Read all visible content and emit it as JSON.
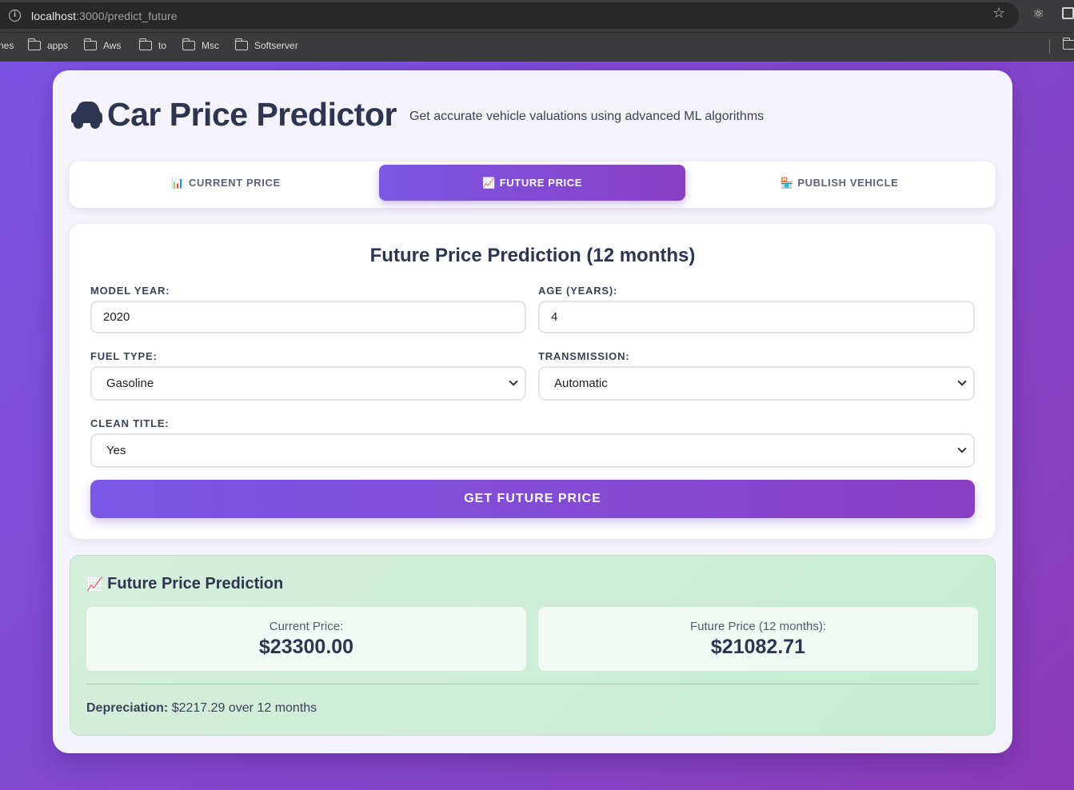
{
  "browser": {
    "url_host": "localhost",
    "url_path": ":3000/predict_future",
    "bookmarks": [
      {
        "label": "nes"
      },
      {
        "label": "apps"
      },
      {
        "label": "Aws"
      },
      {
        "label": "to"
      },
      {
        "label": "Msc"
      },
      {
        "label": "Softserver"
      }
    ]
  },
  "app": {
    "title": "Car Price Predictor",
    "subtitle": "Get accurate vehicle valuations using advanced ML algorithms"
  },
  "tabs": [
    {
      "icon": "📊",
      "label": "CURRENT PRICE",
      "active": false
    },
    {
      "icon": "📈",
      "label": "FUTURE PRICE",
      "active": true
    },
    {
      "icon": "🏪",
      "label": "PUBLISH VEHICLE",
      "active": false
    }
  ],
  "form": {
    "title": "Future Price Prediction (12 months)",
    "model_year": {
      "label": "MODEL YEAR:",
      "value": "2020"
    },
    "age": {
      "label": "AGE (YEARS):",
      "value": "4"
    },
    "fuel_type": {
      "label": "FUEL TYPE:",
      "value": "Gasoline"
    },
    "transmission": {
      "label": "TRANSMISSION:",
      "value": "Automatic"
    },
    "clean_title": {
      "label": "CLEAN TITLE:",
      "value": "Yes"
    },
    "submit_label": "GET FUTURE PRICE"
  },
  "results": {
    "icon": "📈",
    "title": "Future Price Prediction",
    "current_label": "Current Price:",
    "current_value": "$23300.00",
    "future_label": "Future Price (12 months):",
    "future_value": "$21082.71",
    "depreciation_label": "Depreciation:",
    "depreciation_text": "$2217.29 over 12 months"
  },
  "colors": {
    "accent_start": "#7b58e6",
    "accent_end": "#8a3fc4",
    "result_bg": "#c6ebd0",
    "text_dark": "#2d3550"
  }
}
